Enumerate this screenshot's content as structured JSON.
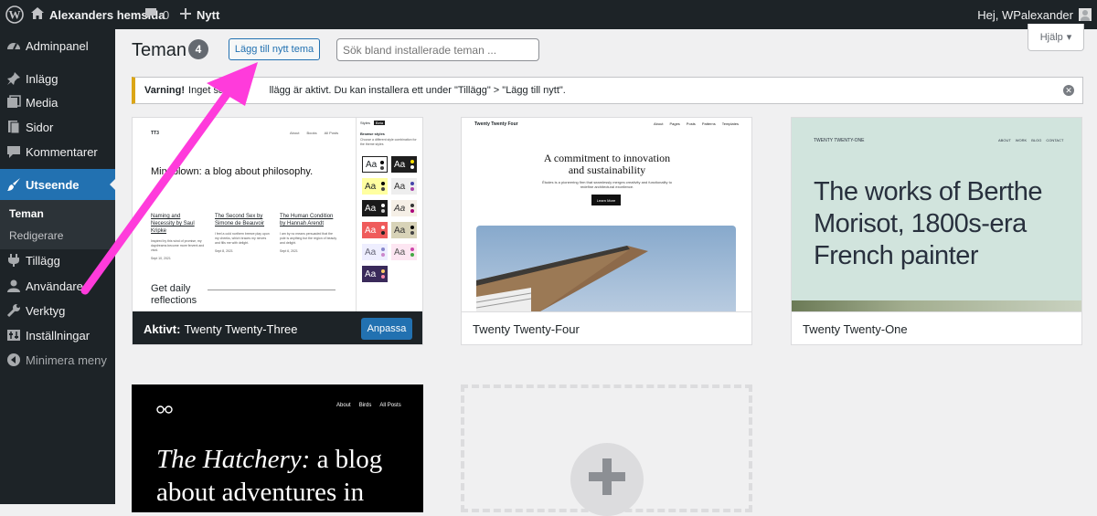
{
  "adminbar": {
    "site": "Alexanders hemsida",
    "comments": "0",
    "new": "Nytt",
    "greeting": "Hej, WPalexander"
  },
  "menu": {
    "dashboard": "Adminpanel",
    "posts": "Inlägg",
    "media": "Media",
    "pages": "Sidor",
    "comments": "Kommentarer",
    "appearance": "Utseende",
    "themes": "Teman",
    "editor": "Redigerare",
    "plugins": "Tillägg",
    "users": "Användare",
    "tools": "Verktyg",
    "settings": "Inställningar",
    "collapse": "Minimera meny"
  },
  "header": {
    "title": "Teman",
    "count": "4",
    "add_new": "Lägg till nytt tema",
    "search_placeholder": "Sök bland installerade teman ...",
    "help": "Hjälp"
  },
  "notice": {
    "strong": "Varning!",
    "text_a": "Inget säkerh",
    "text_b": "llägg är aktivt. Du kan installera ett under \"Tillägg\" > \"Lägg till nytt\"."
  },
  "themes": [
    {
      "name": "Twenty Twenty-Three",
      "active_label": "Aktivt:",
      "customize": "Anpassa",
      "preview": {
        "logo": "TT3",
        "nav": [
          "About",
          "Books",
          "All Posts"
        ],
        "heading": "Mindblown: a blog about philosophy.",
        "posts": [
          {
            "title": "Naming and Necessity by Saul Kripke",
            "excerpt": "Inspired by this wind of promise, my daydreams become more fervent and vivid.",
            "date": "Sept 10, 2021"
          },
          {
            "title": "The Second Sex by Simone de Beauvoir",
            "excerpt": "I feel a cold northern breeze play upon my cheeks, which braces my nerves and fills me with delight.",
            "date": "Sept 8, 2021"
          },
          {
            "title": "The Human Condition by Hannah Arendt",
            "excerpt": "I am by no means persuaded that the pole is anything but the region of beauty and delight.",
            "date": "Sept 6, 2021"
          }
        ],
        "footer_text": "Get daily reflections",
        "styles_tab": "Styles",
        "beta": "Beta",
        "browse": "Browse styles",
        "browse_desc": "Choose a different style combination for the theme styles",
        "swatch": "Aa"
      }
    },
    {
      "name": "Twenty Twenty-Four",
      "preview": {
        "site": "Twenty Twenty Four",
        "nav": [
          "About",
          "Pages",
          "Posts",
          "Patterns",
          "Templates"
        ],
        "heading": "A commitment to innovation and sustainability",
        "desc": "Études is a pioneering firm that seamlessly merges creativity and functionality to redefine architectural excellence.",
        "button": "Learn More"
      }
    },
    {
      "name": "Twenty Twenty-One",
      "preview": {
        "site": "TWENTY TWENTY-ONE",
        "nav": [
          "ABOUT",
          "WORK",
          "BLOG",
          "CONTACT"
        ],
        "heading": "The works of Berthe Morisot, 1800s-era French painter"
      }
    },
    {
      "name": "",
      "preview": {
        "nav": [
          "About",
          "Birds",
          "All Posts"
        ],
        "heading_italic": "The Hatchery:",
        "heading_rest": " a blog about adventures in"
      }
    }
  ],
  "colors": {
    "bar": "#1d2327",
    "accent": "#2271b1",
    "arrow": "#ff3bdb",
    "tt1_bg": "#d1e4dd",
    "warning": "#dba617"
  }
}
